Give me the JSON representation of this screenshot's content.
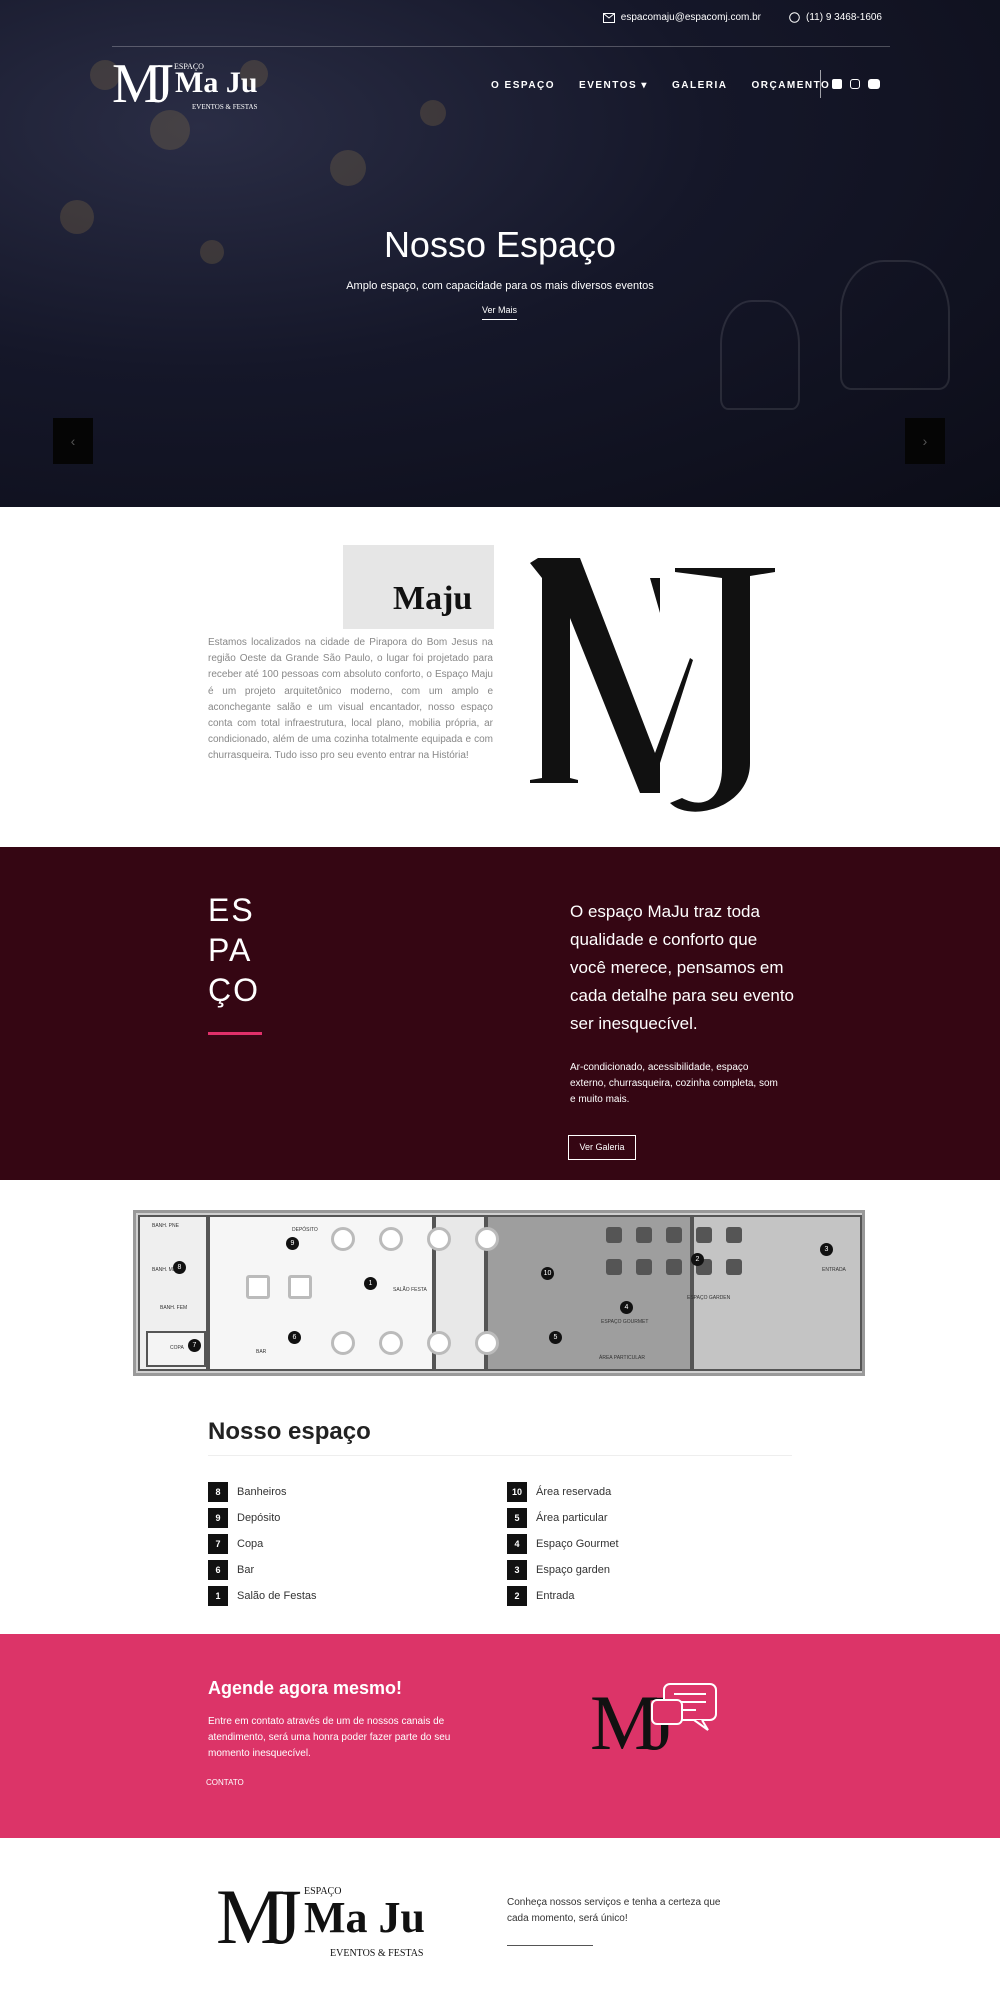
{
  "topbar": {
    "email": "espacomaju@espacomj.com.br",
    "phone": "(11) 9 3468-1606"
  },
  "logo": {
    "mark": "MJ",
    "espaco": "ESPAÇO",
    "name": "Ma Ju",
    "tagline": "EVENTOS & FESTAS"
  },
  "nav": {
    "items": [
      "O ESPAÇO",
      "EVENTOS",
      "GALERIA",
      "ORÇAMENTO"
    ]
  },
  "hero": {
    "title": "Nosso Espaço",
    "subtitle": "Amplo espaço, com capacidade para os mais diversos eventos",
    "button": "Ver Mais",
    "prev": "‹",
    "next": "›"
  },
  "about": {
    "title": "Maju",
    "text": "Estamos localizados na cidade de Pirapora do Bom Jesus na região Oeste da Grande São Paulo, o lugar foi projetado para receber até 100 pessoas com absoluto conforto, o Espaço Maju é um projeto arquitetônico moderno, com um amplo e aconchegante salão e um visual encantador, nosso espaço conta com total infraestrutura, local plano, mobilia própria, ar condicionado, além de uma cozinha totalmente equipada e com churrasqueira. Tudo isso pro seu evento entrar na História!",
    "bigmark": "MJ"
  },
  "espaco": {
    "word": [
      "ES",
      "PA",
      "ÇO"
    ],
    "headline": "O espaço MaJu traz toda qualidade e conforto que você merece, pensamos em cada detalhe para seu evento ser inesquecível.",
    "sub": "Ar-condicionado, acessibilidade, espaço externo, churrasqueira, cozinha completa, som e muito mais.",
    "button": "Ver Galeria"
  },
  "plan": {
    "labels": [
      "BANH. PNE",
      "BANH. MASC",
      "BANH. FEM",
      "DEPÓSITO",
      "COPA",
      "BAR",
      "SALÃO FESTA",
      "ESPAÇO GOURMET",
      "ESPAÇO GARDEN",
      "ÁREA PARTICULAR",
      "ENTRADA"
    ],
    "numbers": [
      "8",
      "9",
      "7",
      "6",
      "1",
      "10",
      "4",
      "5",
      "2",
      "3"
    ]
  },
  "nosso": {
    "title": "Nosso espaço",
    "left": [
      {
        "n": "8",
        "label": "Banheiros"
      },
      {
        "n": "9",
        "label": "Depósito"
      },
      {
        "n": "7",
        "label": "Copa"
      },
      {
        "n": "6",
        "label": "Bar"
      },
      {
        "n": "1",
        "label": "Salão de Festas"
      }
    ],
    "right": [
      {
        "n": "10",
        "label": "Área reservada"
      },
      {
        "n": "5",
        "label": "Área particular"
      },
      {
        "n": "4",
        "label": "Espaço Gourmet"
      },
      {
        "n": "3",
        "label": "Espaço garden"
      },
      {
        "n": "2",
        "label": "Entrada"
      }
    ]
  },
  "cta": {
    "title": "Agende agora mesmo!",
    "text": "Entre em contato através de um de nossos canais de atendimento, será uma honra poder fazer parte do seu momento inesquecível.",
    "button": "CONTATO",
    "mark": "MJ"
  },
  "footer": {
    "text": "Conheça nossos serviços e tenha a certeza que cada momento, será único!"
  },
  "colors": {
    "dark": "#350613",
    "pink": "#dc3468",
    "accent": "#e0306a"
  },
  "icons": [
    "envelope-icon",
    "whatsapp-icon",
    "facebook-icon",
    "instagram-icon",
    "youtube-icon",
    "chevron-left-icon",
    "chevron-right-icon",
    "chat-icon"
  ]
}
